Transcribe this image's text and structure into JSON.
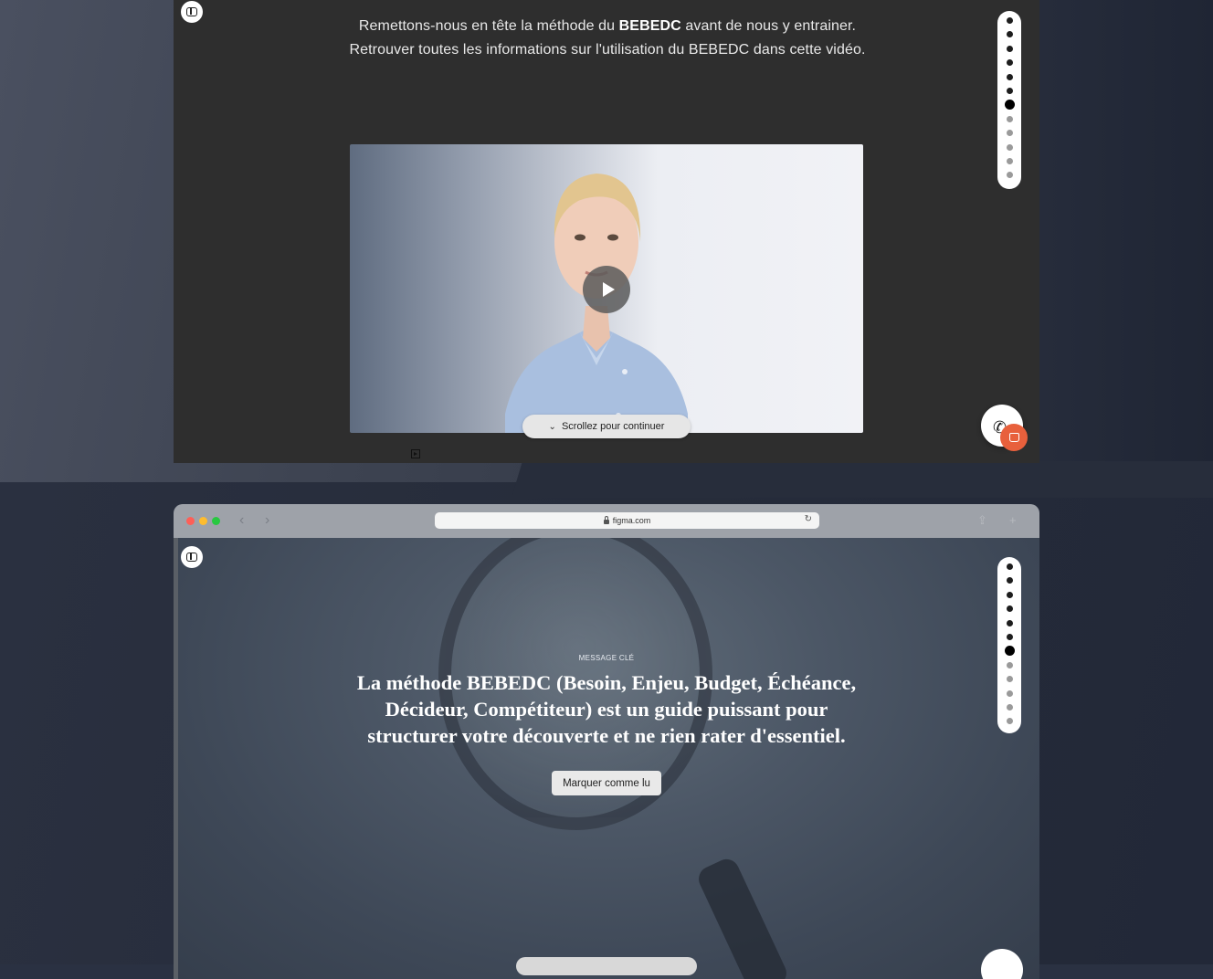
{
  "top_window": {
    "intro_part1": "Remettons-nous en tête la méthode du ",
    "intro_bold": "BEBEDC",
    "intro_part2": " avant de nous y entrainer. Retrouver toutes les informations sur l'utilisation du BEBEDC dans cette vidéo.",
    "scroll_label": "Scrollez pour continuer",
    "progress": {
      "total": 12,
      "current_index": 6
    }
  },
  "bottom_window": {
    "url": "figma.com",
    "kicker": "MESSAGE CLÉ",
    "headline": "La méthode BEBEDC (Besoin, Enjeu, Budget, Échéance, Décideur, Compétiteur) est un guide puissant pour structurer votre découverte et ne rien rater d'essentiel.",
    "mark_read_label": "Marquer comme lu",
    "progress": {
      "total": 12,
      "current_index": 6
    }
  },
  "icons": {
    "sidebar": "sidebar-toggle-icon",
    "play": "play-icon",
    "scroll": "double-chevron-down-icon",
    "call": "phone-icon",
    "chat": "chat-icon",
    "lock": "lock-icon",
    "reload": "reload-icon"
  },
  "colors": {
    "accent_chat": "#e8603c",
    "traffic_red": "#fe5f57",
    "traffic_yellow": "#febc2e",
    "traffic_green": "#28c840"
  }
}
